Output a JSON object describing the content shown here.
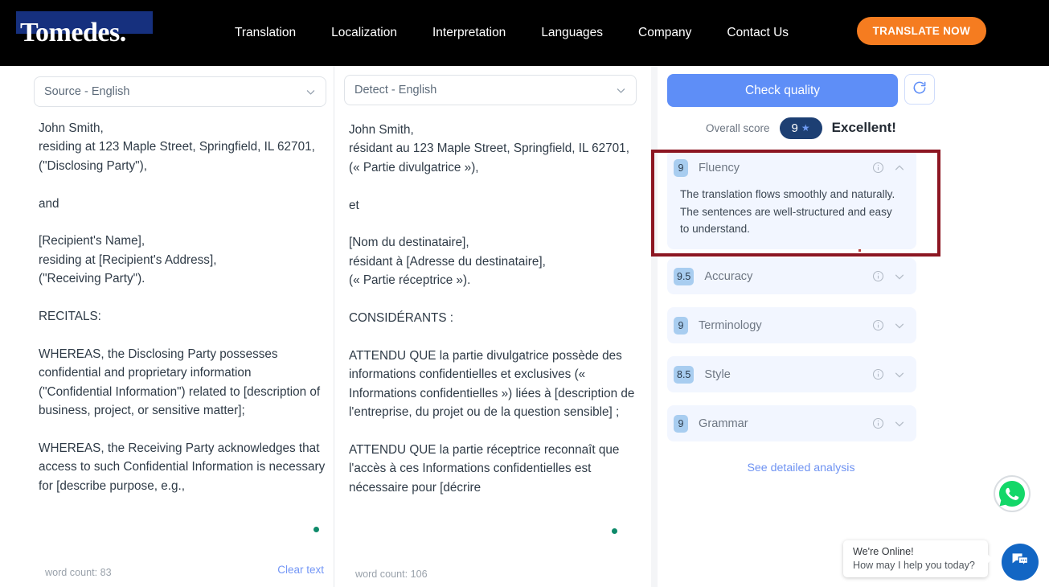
{
  "nav": {
    "logo": "Tomedes.",
    "links": [
      {
        "label": "Translation"
      },
      {
        "label": "Localization"
      },
      {
        "label": "Interpretation"
      },
      {
        "label": "Languages"
      },
      {
        "label": "Company"
      },
      {
        "label": "Contact Us"
      }
    ],
    "cta": "TRANSLATE NOW",
    "cta_color": "#f57c20",
    "bar_color": "#000000",
    "logo_highlight_color": "#16307e"
  },
  "source_panel": {
    "language_select": "Source - English",
    "text": "John Smith,\nresiding at 123 Maple Street, Springfield, IL 62701,\n(\"Disclosing Party\"),\n\nand\n\n[Recipient's Name],\nresiding at [Recipient's Address],\n(\"Receiving Party\").\n\nRECITALS:\n\nWHEREAS, the Disclosing Party possesses confidential and proprietary information (\"Confidential Information\") related to [description of business, project, or sensitive matter];\n\nWHEREAS, the Receiving Party acknowledges that access to such Confidential Information is necessary for [describe purpose, e.g.,",
    "word_count": "word count: 83",
    "clear_text": "Clear text"
  },
  "target_panel": {
    "language_select": "Detect - English",
    "text": "John Smith,\nrésidant au 123 Maple Street, Springfield, IL 62701,\n(« Partie divulgatrice »),\n\net\n\n[Nom du destinataire],\nrésidant à [Adresse du destinataire],\n(« Partie réceptrice »).\n\nCONSIDÉRANTS :\n\nATTENDU QUE la partie divulgatrice possède des informations confidentielles et exclusives (« Informations confidentielles ») liées à [description de l'entreprise, du projet ou de la question sensible] ;\n\nATTENDU QUE la partie réceptrice reconnaît que l'accès à ces Informations confidentielles est nécessaire pour [décrire",
    "word_count": "word count: 106"
  },
  "quality_panel": {
    "check_quality_label": "Check quality",
    "check_quality_color": "#5e8ef7",
    "refresh_icon": "refresh-icon",
    "overall_label": "Overall score",
    "overall_score": "9",
    "overall_star": "★",
    "overall_verdict": "Excellent!",
    "score_pill_color": "#1d3f73",
    "see_detailed_analysis": "See detailed analysis",
    "metrics": [
      {
        "score": "9",
        "name": "Fluency",
        "expanded": true,
        "description": "The translation flows smoothly and naturally. The sentences are well-structured and easy to understand."
      },
      {
        "score": "9.5",
        "name": "Accuracy",
        "expanded": false,
        "description": ""
      },
      {
        "score": "9",
        "name": "Terminology",
        "expanded": false,
        "description": ""
      },
      {
        "score": "8.5",
        "name": "Style",
        "expanded": false,
        "description": ""
      },
      {
        "score": "9",
        "name": "Grammar",
        "expanded": false,
        "description": ""
      }
    ],
    "highlight_color": "#8c1622"
  },
  "widgets": {
    "whatsapp_icon": "whatsapp-icon",
    "chat_icon": "chat-icon",
    "chat_tip_title": "We're Online!",
    "chat_tip_subtitle": "How may I help you today?"
  }
}
